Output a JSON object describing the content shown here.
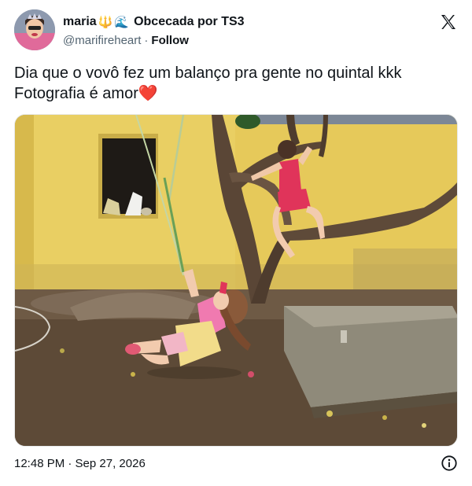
{
  "author": {
    "display_name": "maria",
    "trident_emoji": "🔱",
    "wave_emoji": "🌊",
    "name_suffix": "Obcecada por TS3",
    "handle": "@marifireheart",
    "separator": "·",
    "follow_label": "Follow"
  },
  "tweet": {
    "text_line1": "Dia que o vovô fez um balanço pra gente no quintal kkk",
    "text_line2": "Fotografia é amor",
    "heart_emoji": "❤️"
  },
  "footer": {
    "timestamp": "12:48 PM · Sep 27, 2026"
  },
  "icons": {
    "brand": "x-logo-icon",
    "info": "info-icon"
  },
  "colors": {
    "text": "#0f1419",
    "secondary": "#536471",
    "wall": "#e9cf63",
    "heart": "#e0243b"
  }
}
